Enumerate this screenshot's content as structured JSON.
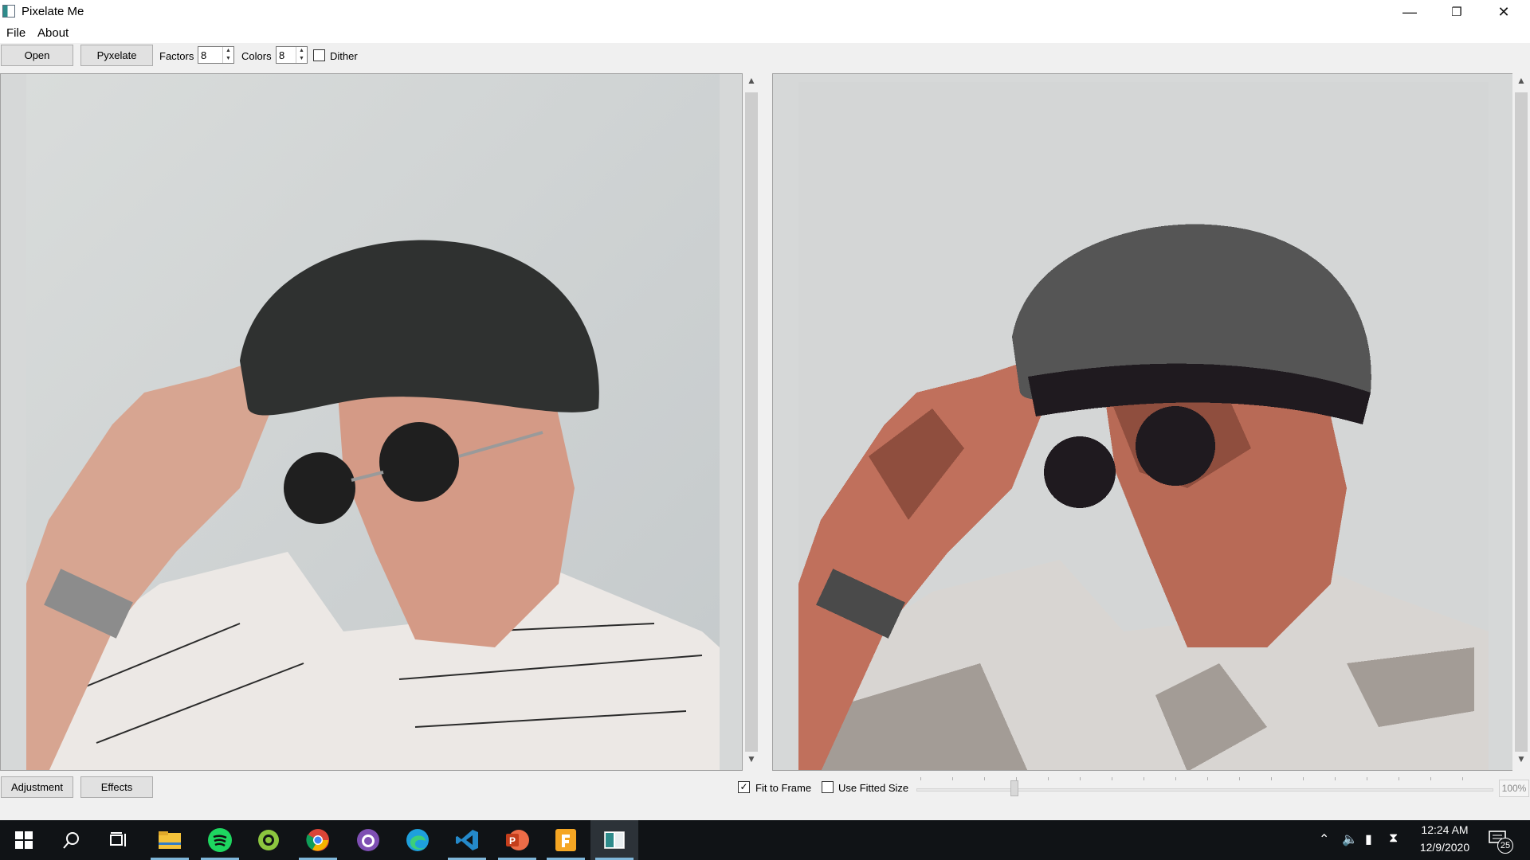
{
  "window": {
    "title": "Pixelate Me"
  },
  "menu": {
    "items": [
      "File",
      "About"
    ]
  },
  "toolbar": {
    "open_label": "Open",
    "pyxelate_label": "Pyxelate",
    "factors_label": "Factors",
    "factors_value": "8",
    "colors_label": "Colors",
    "colors_value": "8",
    "dither_label": "Dither",
    "dither_checked": false
  },
  "bottom": {
    "adjustment_label": "Adjustment",
    "effects_label": "Effects",
    "fit_to_frame_label": "Fit to Frame",
    "fit_to_frame_checked": true,
    "use_fitted_size_label": "Use Fitted Size",
    "use_fitted_size_checked": false,
    "zoom_value": "100%"
  },
  "taskbar": {
    "apps": [
      "windows-start-icon",
      "search-icon",
      "task-view-icon",
      "file-explorer-icon",
      "spotify-icon",
      "greenshot-icon",
      "chrome-icon",
      "github-desktop-icon",
      "edge-icon",
      "vscode-icon",
      "powerpoint-icon",
      "foxit-pdf-icon",
      "pixelate-me-icon"
    ],
    "time": "12:24 AM",
    "date": "12/9/2020",
    "notification_count": "25"
  },
  "colors": {
    "canvas_bg": "#d6d8d8",
    "taskbar_bg": "#101316",
    "active_underline": "#7fb6d9"
  }
}
